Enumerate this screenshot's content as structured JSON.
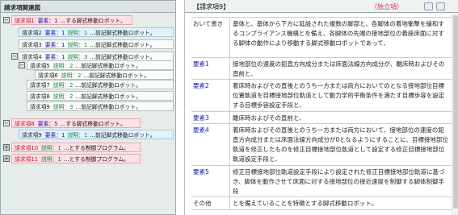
{
  "tree": {
    "title": "請求項関連図",
    "rows": [
      {
        "label": "請求項1",
        "req": "要素：1",
        "exp": "",
        "text": "…する脚式移動ロボット。"
      },
      {
        "label": "請求項2",
        "req": "要素：1",
        "exp": "説明：1",
        "text": "…前記脚式移動ロボット。"
      },
      {
        "label": "請求項3",
        "req": "要素：1",
        "exp": "説明：1",
        "text": "…前記脚式移動ロボット。"
      },
      {
        "label": "請求項4",
        "req": "要素：1",
        "exp": "説明：3",
        "text": "…前記脚式移動ロボット。"
      },
      {
        "label": "請求項5",
        "req": "",
        "exp": "説明：2",
        "text": "…前記脚式移動ロボット。"
      },
      {
        "label": "請求項6",
        "req": "",
        "exp": "説明：2",
        "text": "…前記脚式移動ロボット。"
      },
      {
        "label": "請求項7",
        "req": "",
        "exp": "説明：2",
        "text": "…前記脚式移動ロボット。"
      },
      {
        "label": "請求項8",
        "req": "",
        "exp": "説明：2",
        "text": "…前記脚式移動ロボット。"
      },
      {
        "label": "請求項9",
        "req": "",
        "exp": "説明：3",
        "text": "…前記脚式移動ロボット。"
      },
      {
        "label": "請求項8",
        "req": "要素：5",
        "exp": "",
        "text": "…する脚式移動ロボット。"
      },
      {
        "label": "請求項9",
        "req": "要素：1",
        "exp": "説明：1",
        "text": "…前記脚式移動ロボット。"
      },
      {
        "label": "請求項10",
        "req": "",
        "exp": "説明：1",
        "text": "…とする制御プログラム。"
      },
      {
        "label": "請求項11",
        "req": "",
        "exp": "説明：1",
        "text": "…とする制御プログラム。"
      }
    ]
  },
  "detail": {
    "title": "【請求項9】",
    "type": "（独立項）",
    "rows": [
      {
        "label": "おいて書き",
        "text": "基体と、基体から下方に延設された複数の脚部と、各脚体の着地衝撃を緩和するコンプライアンス機構とを備え、各脚体の先端の接地部位の着座床面に対する脚体の動作により移動する脚式移動ロボットであって、"
      },
      {
        "label": "要素1",
        "text": "接地部位の速度の鉛直方向成分または床面法線方向成分が、離床時およびその直前と、"
      },
      {
        "label": "要素2",
        "text": "着床時およびその直後とのうち一方または両方においてのとなる接地部位目標位置軌道を目標接地部位軌道として動力学的平衡条件を満たす目標歩容を設定する目標歩容設定手段と、"
      },
      {
        "label": "要素3",
        "text": "離床時およびその直前と、"
      },
      {
        "label": "要素4",
        "text": "着床時およびその直後とのうち一方または両方において、接地部位の速度の鉛直方向成分または床面法線方向成分が0となるようにすることに、目標接地部位軌道を修正したものを修正目標接地部位軌道として設定する修正目標接地部位軌道設定手段と、"
      },
      {
        "label": "要素5",
        "text": "修正目標接地部位軌道設定手段により設定された修正目標接地部位軌道に基づき、脚体を動作させて床面に対する接地部位の接近速度を制御する脚体制御手段"
      },
      {
        "label": "その他",
        "text": "とを備えていることを特徴とする脚式移動ロボット。"
      }
    ]
  },
  "colors": {
    "pink": "#fbe0e4",
    "blue": "#e3f1fb",
    "accent": "#d8306a",
    "key": "#1a1ab0"
  }
}
